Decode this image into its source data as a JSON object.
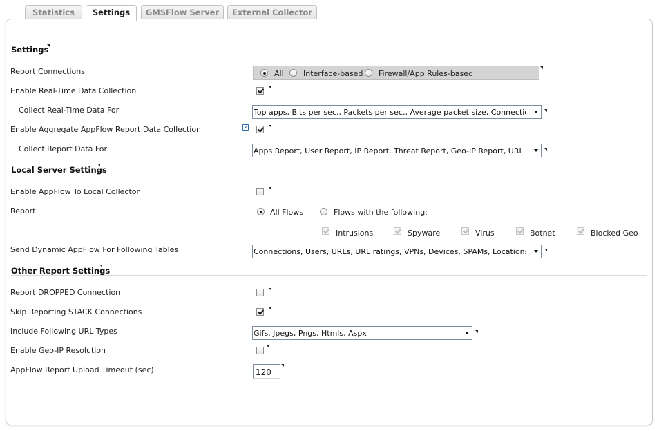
{
  "tabs": [
    {
      "label": "Statistics",
      "active": false
    },
    {
      "label": "Settings",
      "active": true
    },
    {
      "label": "GMSFlow Server",
      "active": false
    },
    {
      "label": "External Collector",
      "active": false
    }
  ],
  "settings": {
    "heading": "Settings",
    "report_connections": {
      "label": "Report Connections",
      "options": [
        {
          "label": "All",
          "selected": true
        },
        {
          "label": "Interface-based",
          "selected": false
        },
        {
          "label": "Firewall/App Rules-based",
          "selected": false
        }
      ]
    },
    "realtime": {
      "label": "Enable Real-Time Data Collection",
      "checked": true
    },
    "realtime_for": {
      "label": "Collect Real-Time Data For",
      "value": "Top apps, Bits per sec., Packets per sec., Average packet size, Connections per"
    },
    "aggregate": {
      "label": "Enable Aggregate AppFlow Report Data Collection",
      "checked": true,
      "icon": "external-link-icon"
    },
    "report_for": {
      "label": "Collect Report Data For",
      "value": "Apps Report, User Report, IP Report, Threat Report, Geo-IP Report, URL Report"
    }
  },
  "local_server": {
    "heading": "Local Server Settings",
    "enable_local": {
      "label": "Enable AppFlow To Local Collector",
      "checked": false
    },
    "report": {
      "label": "Report",
      "all_flows": {
        "label": "All Flows",
        "selected": true
      },
      "flows_with": {
        "label": "Flows with the following:",
        "selected": false
      },
      "filters": [
        {
          "label": "Intrusions",
          "checked": true
        },
        {
          "label": "Spyware",
          "checked": true
        },
        {
          "label": "Virus",
          "checked": true
        },
        {
          "label": "Botnet",
          "checked": true
        },
        {
          "label": "Blocked Geo",
          "checked": true
        }
      ]
    },
    "dynamic": {
      "label": "Send Dynamic AppFlow For Following Tables",
      "value": "Connections, Users, URLs, URL ratings, VPNs, Devices, SPAMs, Locations, VOIPs"
    }
  },
  "other": {
    "heading": "Other Report Settings",
    "dropped": {
      "label": "Report DROPPED Connection",
      "checked": false
    },
    "stack": {
      "label": "Skip Reporting STACK Connections",
      "checked": true
    },
    "url_types": {
      "label": "Include Following URL Types",
      "value": "Gifs, Jpegs, Pngs, Htmls, Aspx"
    },
    "geoip": {
      "label": "Enable Geo-IP Resolution",
      "checked": false
    },
    "timeout": {
      "label": "AppFlow Report Upload Timeout (sec)",
      "value": "120"
    }
  },
  "colors": {
    "accent": "#2a68a8",
    "radio_group_bg": "#d4d4d4"
  }
}
